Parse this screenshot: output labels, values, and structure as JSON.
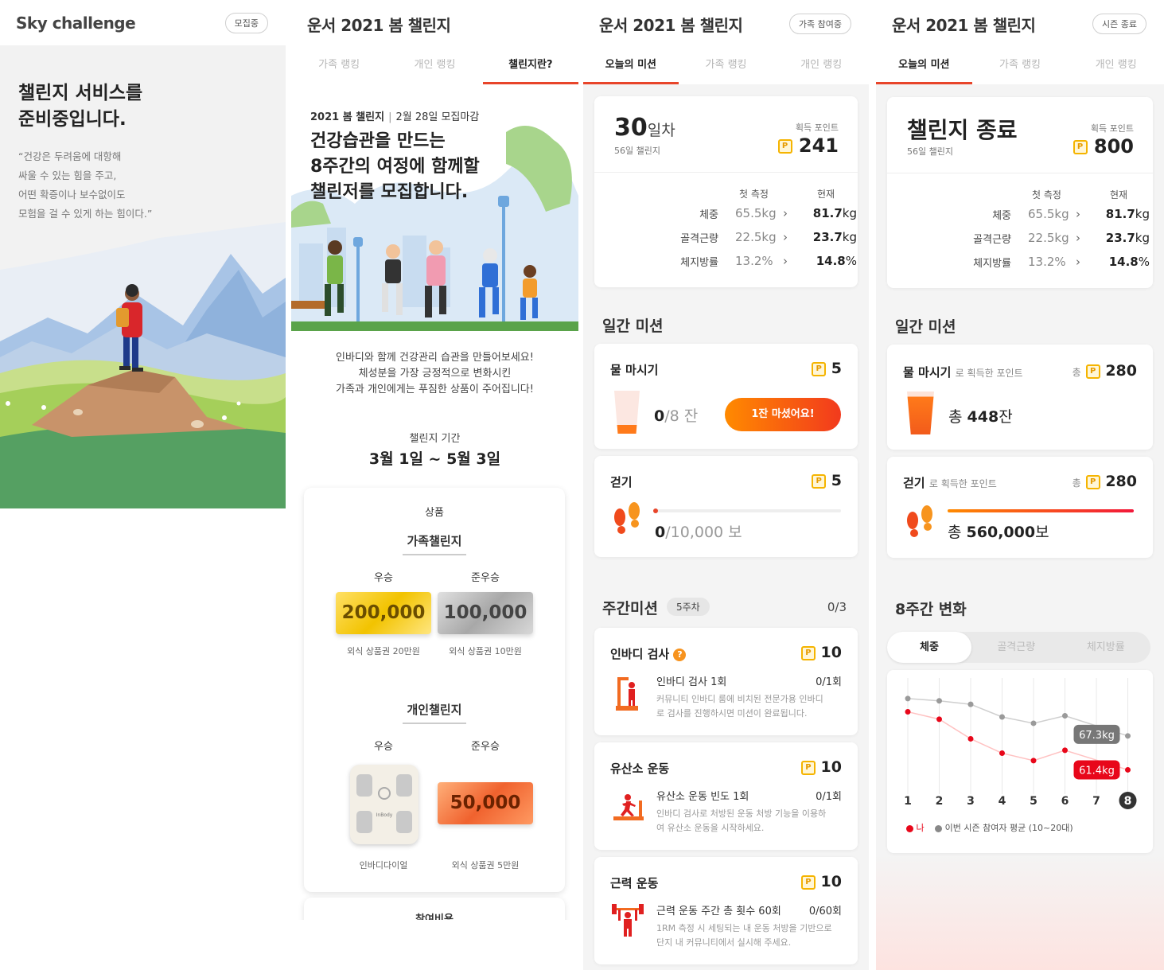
{
  "s1": {
    "title": "Sky challenge",
    "badge": "모집중",
    "heading1": "챌린지 서비스를",
    "heading2": "준비중입니다.",
    "quote": [
      "“건강은 두려움에 대항해",
      "싸울 수 있는 힘을 주고,",
      "어떤 확증이나 보수없이도",
      "모험을 걸 수 있게 하는 힘이다.”"
    ]
  },
  "s2": {
    "title": "운서 2021 봄 챌린지",
    "tabs": [
      "가족 랭킹",
      "개인 랭킹",
      "챌린지란?"
    ],
    "banner_label": "2021 봄 챌린지",
    "banner_deadline": "2월 28일 모집마감",
    "banner_lines": [
      "건강습관을 만드는",
      "8주간의 여정에 함께할",
      "챌린저를 모집합니다."
    ],
    "desc": [
      "인바디와 함께 건강관리 습관을 만들어보세요!",
      "체성분을 가장 긍정적으로 변화시킨",
      "가족과 개인에게는 푸짐한 상품이 주어집니다!"
    ],
    "period_label": "챌린지 기간",
    "period": "3월 1일 ~ 5월 3일",
    "prize_title": "상품",
    "family": {
      "title": "가족챌린지",
      "first": "우승",
      "second": "준우승",
      "first_value": "200,000",
      "second_value": "100,000",
      "first_desc": "외식 상품권 20만원",
      "second_desc": "외식 상품권 10만원"
    },
    "personal": {
      "title": "개인챌린지",
      "first": "우승",
      "second": "준우승",
      "device_brand": "InBody",
      "second_value": "50,000",
      "first_desc": "인바디다이얼",
      "second_desc": "외식 상품권 5만원"
    },
    "next_title": "참여비용"
  },
  "s3": {
    "title": "운서 2021 봄 챌린지",
    "badge": "가족 참여중",
    "tabs": [
      "오늘의 미션",
      "가족 랭킹",
      "개인 랭킹"
    ],
    "day_num": "30",
    "day_unit": "일차",
    "day_sub": "56일 챌린지",
    "points_label": "획득 포인트",
    "points": "241",
    "col_first": "첫 측정",
    "col_now": "현재",
    "metrics": [
      {
        "name": "체중",
        "first": "65.5kg",
        "now": "81.7",
        "unit": "kg"
      },
      {
        "name": "골격근량",
        "first": "22.5kg",
        "now": "23.7",
        "unit": "kg"
      },
      {
        "name": "체지방률",
        "first": "13.2%",
        "now": "14.8",
        "unit": "%"
      }
    ],
    "daily_title": "일간 미션",
    "water": {
      "title": "물 마시기",
      "points": "5",
      "count": "0",
      "total": "/8 잔",
      "button": "1잔 마셨어요!"
    },
    "walk": {
      "title": "걷기",
      "points": "5",
      "count": "0",
      "total": "/10,000 보"
    },
    "weekly_title": "주간미션",
    "week_badge": "5주차",
    "weekly_progress": "0/3",
    "inbody": {
      "title": "인바디 검사",
      "help": "?",
      "points": "10",
      "task": "인바디 검사 1회",
      "count": "0/1회",
      "desc1": "커뮤니티 인바디 룸에 비치된 전문가용 인바디",
      "desc2": "로 검사를 진행하시면 미션이 완료됩니다."
    },
    "cardio": {
      "title": "유산소 운동",
      "points": "10",
      "task": "유산소 운동 빈도 1회",
      "count": "0/1회",
      "desc1": "인바디 검사로 처방된 운동 처방 기능을 이용하",
      "desc2": "여 유산소 운동을 시작하세요."
    },
    "strength": {
      "title": "근력 운동",
      "points": "10",
      "task": "근력 운동 주간 총 횟수 60회",
      "count": "0/60회",
      "desc1": "1RM 측정 시 세팅되는 내 운동 처방을 기반으로",
      "desc2": "단지 내 커뮤니티에서 실시해 주세요."
    }
  },
  "s4": {
    "title": "운서 2021 봄 챌린지",
    "badge": "시즌 종료",
    "tabs": [
      "오늘의 미션",
      "가족 랭킹",
      "개인 랭킹"
    ],
    "end_title": "챌린지 종료",
    "day_sub": "56일 챌린지",
    "points_label": "획득 포인트",
    "points": "800",
    "col_first": "첫 측정",
    "col_now": "현재",
    "metrics": [
      {
        "name": "체중",
        "first": "65.5kg",
        "now": "81.7",
        "unit": "kg"
      },
      {
        "name": "골격근량",
        "first": "22.5kg",
        "now": "23.7",
        "unit": "kg"
      },
      {
        "name": "체지방률",
        "first": "13.2%",
        "now": "14.8",
        "unit": "%"
      }
    ],
    "daily_title": "일간 미션",
    "water": {
      "title": "물 마시기",
      "sub": "로 획득한 포인트",
      "total_label": "총",
      "points": "280",
      "sum_prefix": "총",
      "sum": "448",
      "sum_unit": "잔"
    },
    "walk": {
      "title": "걷기",
      "sub": "로 획득한 포인트",
      "total_label": "총",
      "points": "280",
      "sum_prefix": "총",
      "sum": "560,000",
      "sum_unit": "보"
    },
    "chart_title": "8주간 변화",
    "chart_tabs": [
      "체중",
      "골격근량",
      "체지방률"
    ],
    "legend_me": "나",
    "legend_avg": "이번 시즌 참여자 평균 (10~20대)",
    "label_avg": "67.3kg",
    "label_me": "61.4kg"
  },
  "colors": {
    "accent": "#e8452a",
    "point": "#f5b400",
    "orange": "#ff6a00"
  },
  "chart_data": {
    "type": "line",
    "x": [
      1,
      2,
      3,
      4,
      5,
      6,
      7,
      8
    ],
    "series": [
      {
        "name": "나",
        "values": [
          71.5,
          70.2,
          66.8,
          64.3,
          63.0,
          64.8,
          null,
          61.4
        ]
      },
      {
        "name": "이번 시즌 참여자 평균 (10~20대)",
        "values": [
          73.8,
          73.4,
          72.8,
          70.6,
          69.5,
          70.8,
          null,
          67.3
        ]
      }
    ]
  }
}
